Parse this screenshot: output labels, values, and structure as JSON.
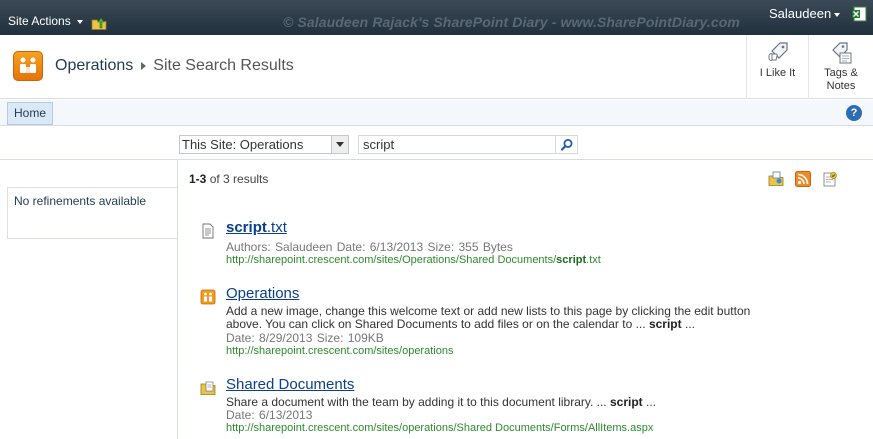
{
  "topbar": {
    "site_actions": "Site Actions",
    "watermark": "© Salaudeen Rajack's SharePoint Diary - www.SharePointDiary.com",
    "user": "Salaudeen"
  },
  "title": {
    "site": "Operations",
    "page": "Site Search Results",
    "like_label": "I Like It",
    "tags_label_1": "Tags &",
    "tags_label_2": "Notes"
  },
  "nav": {
    "home": "Home",
    "help": "?"
  },
  "search": {
    "scope": "This Site: Operations",
    "query": "script"
  },
  "refinement": {
    "text": "No refinements available"
  },
  "results_count": {
    "range": "1-3",
    "rest": "of 3 results"
  },
  "results": [
    {
      "title_bold": "script",
      "title_rest": ".txt",
      "meta": "Authors:  Salaudeen   Date: 6/13/2013   Size: 355 Bytes",
      "url_prefix": "http://sharepoint.crescent.com/sites/Operations/Shared Documents/",
      "url_bold": "script",
      "url_suffix": ".txt"
    },
    {
      "title": "Operations",
      "body_1": "Add a new image, change this welcome text or add new lists to this page by clicking the edit button",
      "body_2a": "above. You can click on Shared Documents to add files or on the calendar to ...",
      "body_bold": "script",
      "body_2b": "...",
      "meta": "Date: 8/29/2013   Size: 109KB",
      "url": "http://sharepoint.crescent.com/sites/operations"
    },
    {
      "title": "Shared Documents",
      "body_a": "Share a document with the team by adding it to this document library. ...",
      "body_bold": "script",
      "body_b": "...",
      "meta": "Date: 6/13/2013",
      "url": "http://sharepoint.crescent.com/sites/operations/Shared Documents/Forms/AllItems.aspx"
    }
  ]
}
